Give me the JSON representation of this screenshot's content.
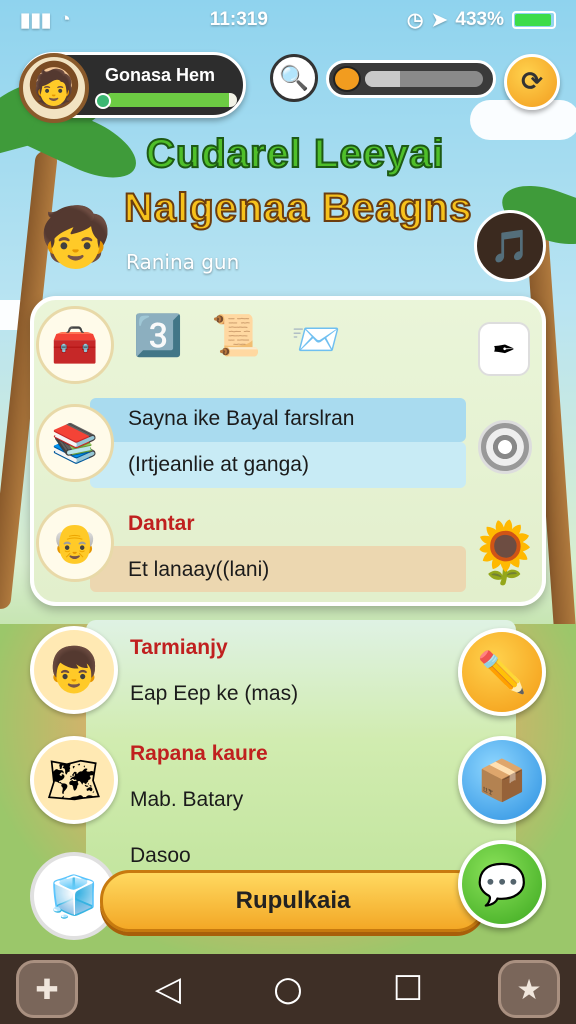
{
  "status_bar": {
    "signal": "∙∙∙ 11··",
    "time": "11:319",
    "battery": "433%"
  },
  "profile": {
    "name": "Gonasa Hem",
    "xp_fraction": 0.94
  },
  "level_progress": {
    "fraction": 0.3
  },
  "title": {
    "line1": "Cudarel Leeyai",
    "line2": "Nalgenaa Beagns",
    "subtitle": "Ranina gun"
  },
  "panel": {
    "row1": {
      "text": "Sayna ike Bayal farslran",
      "sub": "(Irtjeanlie at ganga)"
    },
    "row2": {
      "heading": "Dantar",
      "text": "Et lanaay((lani)"
    }
  },
  "list": [
    {
      "heading": "Tarmianjy",
      "text": "Eap  Eep ke (mas)"
    },
    {
      "heading": "Rapana kaure",
      "text": "Mab. Batary"
    },
    {
      "heading": "Dasoo",
      "text": ""
    }
  ],
  "cta": {
    "label": "Rupulkaia"
  },
  "colors": {
    "accent_orange": "#f29c1f",
    "title_green": "#4fbf2a",
    "title_yellow": "#f6c21c",
    "heading_red": "#c0201f"
  }
}
